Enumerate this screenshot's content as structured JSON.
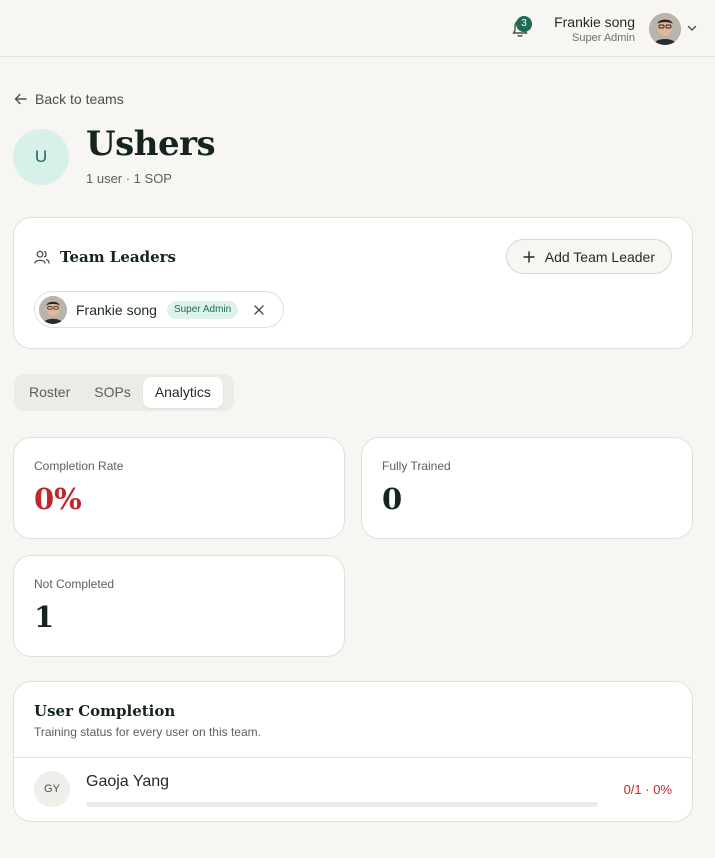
{
  "topbar": {
    "notifications_count": "3",
    "user_name": "Frankie song",
    "user_role": "Super Admin"
  },
  "back_label": "Back to teams",
  "team": {
    "initial": "U",
    "name": "Ushers",
    "meta": "1 user · 1 SOP"
  },
  "leaders": {
    "title": "Team Leaders",
    "add_button_label": "Add Team Leader",
    "items": [
      {
        "name": "Frankie song",
        "role_badge": "Super Admin"
      }
    ]
  },
  "tabs": [
    {
      "label": "Roster",
      "active": false
    },
    {
      "label": "SOPs",
      "active": false
    },
    {
      "label": "Analytics",
      "active": true
    }
  ],
  "stats": {
    "completion_rate": {
      "label": "Completion Rate",
      "value": "0%"
    },
    "fully_trained": {
      "label": "Fully Trained",
      "value": "0"
    },
    "not_completed": {
      "label": "Not Completed",
      "value": "1"
    }
  },
  "user_completion": {
    "title": "User Completion",
    "subtitle": "Training status for every user on this team.",
    "rows": [
      {
        "initials": "GY",
        "name": "Gaoja Yang",
        "score": "0/1 · 0%",
        "progress": 0
      }
    ]
  },
  "colors": {
    "accent": "#1d6b56",
    "danger": "#c0272d",
    "background": "#f7f6f3"
  }
}
